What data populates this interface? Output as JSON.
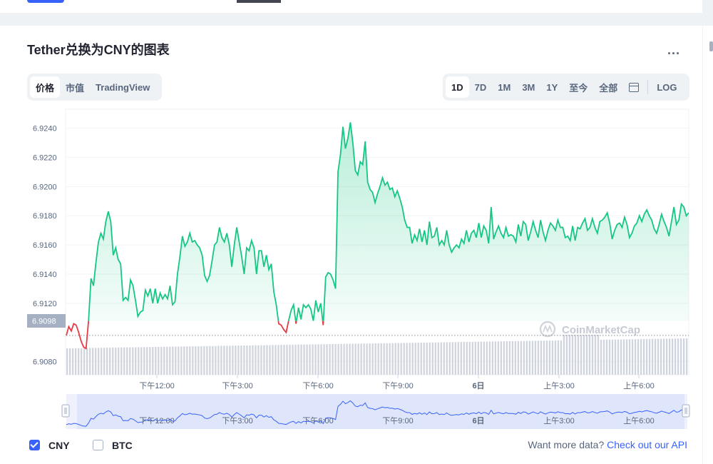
{
  "header": {
    "title": "Tether兑换为CNY的图表",
    "more_label": "..."
  },
  "view_tabs": [
    {
      "label": "价格",
      "active": true
    },
    {
      "label": "市值",
      "active": false
    },
    {
      "label": "TradingView",
      "active": false
    }
  ],
  "range_tabs": [
    {
      "label": "1D",
      "active": true
    },
    {
      "label": "7D",
      "active": false
    },
    {
      "label": "1M",
      "active": false
    },
    {
      "label": "3M",
      "active": false
    },
    {
      "label": "1Y",
      "active": false
    },
    {
      "label": "至今",
      "active": false
    },
    {
      "label": "全部",
      "active": false
    }
  ],
  "icons": {
    "calendar": "calendar-icon",
    "more": "more-icon",
    "checkbox": "check-icon",
    "watermark": "coinmarketcap-logo-icon"
  },
  "log_label": "LOG",
  "watermark": "CoinMarketCap",
  "currencies": [
    {
      "label": "CNY",
      "checked": true
    },
    {
      "label": "BTC",
      "checked": false
    }
  ],
  "api_prompt": {
    "text": "Want more data? ",
    "link": "Check out our API"
  },
  "colors": {
    "up": "#16c784",
    "down": "#ea3943",
    "accent": "#3861fb",
    "baseline_label_bg": "#a6b0c3"
  },
  "chart_data": {
    "type": "line",
    "series": [
      {
        "values": [
          6.9098,
          6.9104,
          6.9101,
          6.9106,
          6.9105,
          6.91,
          6.9094,
          6.909,
          6.9089,
          6.9108,
          6.9137,
          6.9132,
          6.9148,
          6.9162,
          6.9168,
          6.9164,
          6.9176,
          6.9183,
          6.9176,
          6.9153,
          6.9158,
          6.915,
          6.9147,
          6.9122,
          6.9124,
          6.9122,
          6.9136,
          6.9132,
          6.9122,
          6.9111,
          6.9114,
          6.9115,
          6.9129,
          6.9125,
          6.913,
          6.912,
          6.913,
          6.912,
          6.9127,
          6.9123,
          6.9126,
          6.9123,
          6.9132,
          6.9119,
          6.9121,
          6.914,
          6.9152,
          6.9166,
          6.9159,
          6.9162,
          6.9168,
          6.9162,
          6.9163,
          6.916,
          6.9158,
          6.9153,
          6.9139,
          6.9135,
          6.9139,
          6.9149,
          6.916,
          6.9162,
          6.9172,
          6.9165,
          6.9162,
          6.9168,
          6.916,
          6.9145,
          6.916,
          6.9172,
          6.9162,
          6.9152,
          6.914,
          6.9158,
          6.9156,
          6.9163,
          6.9158,
          6.914,
          6.9156,
          6.9156,
          6.9145,
          6.9153,
          6.9143,
          6.9147,
          6.9128,
          6.9119,
          6.9106,
          6.9105,
          6.9102,
          6.91,
          6.9108,
          6.9115,
          6.9119,
          6.9106,
          6.9117,
          6.9109,
          6.9119,
          6.9117,
          6.9119,
          6.9116,
          6.9108,
          6.9122,
          6.9114,
          6.912,
          6.9105,
          6.9138,
          6.9141,
          6.914,
          6.9136,
          6.913,
          6.921,
          6.9222,
          6.9241,
          6.9226,
          6.9233,
          6.9244,
          6.923,
          6.9211,
          6.9208,
          6.9217,
          6.9215,
          6.9231,
          6.9203,
          6.9198,
          6.9196,
          6.9189,
          6.9195,
          6.92,
          6.9206,
          6.9201,
          6.9203,
          6.9198,
          6.9199,
          6.9193,
          6.9197,
          6.9192,
          6.9186,
          6.9177,
          6.9172,
          6.9172,
          6.9161,
          6.9167,
          6.9163,
          6.9171,
          6.9162,
          6.917,
          6.916,
          6.9176,
          6.9165,
          6.9166,
          6.9172,
          6.916,
          6.9163,
          6.916,
          6.917,
          6.916,
          6.9155,
          6.9158,
          6.916,
          6.9158,
          6.9164,
          6.9161,
          6.917,
          6.9162,
          6.9168,
          6.917,
          6.9165,
          6.9175,
          6.9165,
          6.9173,
          6.917,
          6.9161,
          6.9186,
          6.9164,
          6.9169,
          6.9173,
          6.9168,
          6.9165,
          6.9172,
          6.9166,
          6.9167,
          6.9166,
          6.9162,
          6.9174,
          6.9166,
          6.9176,
          6.9174,
          6.9163,
          6.9169,
          6.9176,
          6.917,
          6.9165,
          6.9177,
          6.9169,
          6.9163,
          6.917,
          6.9175,
          6.9173,
          6.917,
          6.9177,
          6.9172,
          6.9172,
          6.9165,
          6.9166,
          6.9163,
          6.9173,
          6.9163,
          6.9172,
          6.9171,
          6.9175,
          6.9178,
          6.917,
          6.9172,
          6.9178,
          6.9172,
          6.9168,
          6.9176,
          6.9177,
          6.9179,
          6.9182,
          6.9175,
          6.9164,
          6.917,
          6.9174,
          6.9175,
          6.9172,
          6.9179,
          6.9174,
          6.9165,
          6.9168,
          6.9173,
          6.9175,
          6.918,
          6.9176,
          6.9181,
          6.9184,
          6.918,
          6.9177,
          6.9171,
          6.9168,
          6.9174,
          6.9181,
          6.9176,
          6.9172,
          6.9166,
          6.9176,
          6.9186,
          6.9174,
          6.9177,
          6.9188,
          6.9186,
          6.918,
          6.9182
        ]
      }
    ],
    "x_ticks": [
      "下午12:00",
      "下午3:00",
      "下午6:00",
      "下午9:00",
      "6日",
      "上午3:00",
      "上午6:00"
    ],
    "y_ticks": [
      6.924,
      6.922,
      6.92,
      6.918,
      6.916,
      6.914,
      6.912,
      6.908
    ],
    "ylim": [
      6.9071,
      6.9253
    ],
    "baseline": 6.9098,
    "baseline_label": "6.9098",
    "volume_visible": true,
    "navigator_visible": true,
    "legend": "none"
  }
}
